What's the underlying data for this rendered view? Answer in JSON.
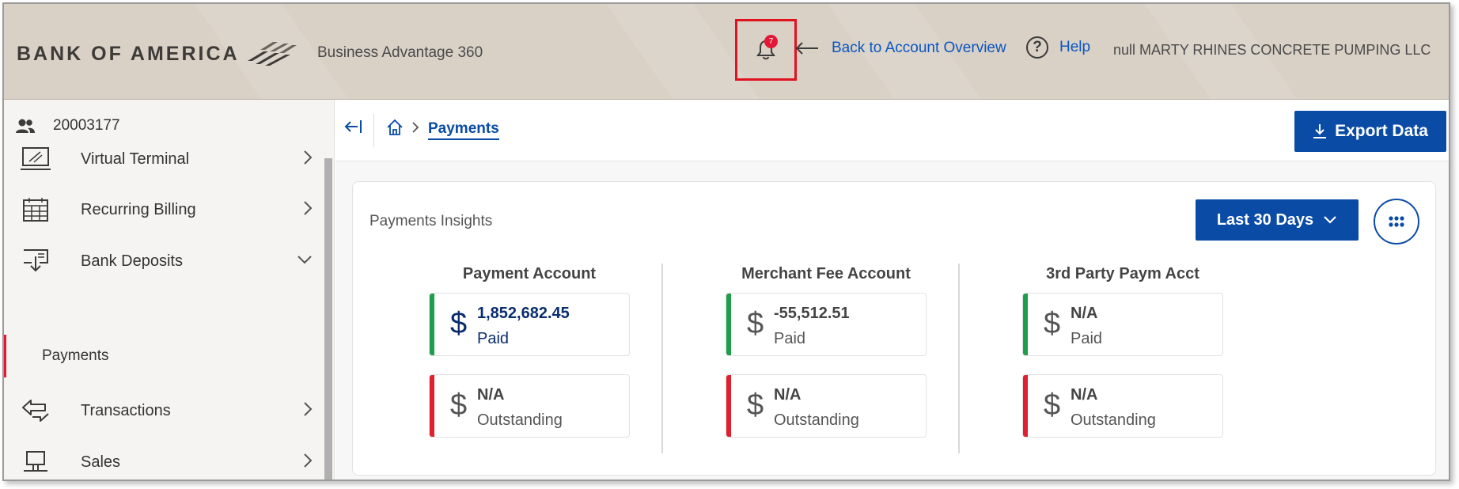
{
  "header": {
    "logo": "BANK OF AMERICA",
    "product": "Business Advantage 360",
    "notification_count": "7",
    "back_link": "Back to Account Overview",
    "help": "Help",
    "company": "null MARTY RHINES CONCRETE PUMPING LLC"
  },
  "sidebar": {
    "account_number": "20003177",
    "items": [
      {
        "label": "Virtual Terminal",
        "icon": "terminal-icon"
      },
      {
        "label": "Recurring Billing",
        "icon": "calendar-icon"
      },
      {
        "label": "Bank Deposits",
        "icon": "deposit-icon"
      },
      {
        "label": "Transactions",
        "icon": "transfer-arrows-icon"
      },
      {
        "label": "Sales",
        "icon": "register-icon"
      }
    ],
    "sub_item": "Payments"
  },
  "breadcrumb": {
    "current": "Payments"
  },
  "toolbar": {
    "export_label": "Export Data"
  },
  "insights": {
    "title": "Payments Insights",
    "range_label": "Last 30 Days",
    "columns": [
      {
        "title": "Payment Account",
        "paid_value": "1,852,682.45",
        "paid_label": "Paid",
        "outstanding_value": "N/A",
        "outstanding_label": "Outstanding"
      },
      {
        "title": "Merchant Fee Account",
        "paid_value": "-55,512.51",
        "paid_label": "Paid",
        "outstanding_value": "N/A",
        "outstanding_label": "Outstanding"
      },
      {
        "title": "3rd Party Paym Acct",
        "paid_value": "N/A",
        "paid_label": "Paid",
        "outstanding_value": "N/A",
        "outstanding_label": "Outstanding"
      }
    ],
    "currency_symbol": "$"
  },
  "colors": {
    "brand_blue": "#0a4ba6",
    "paid_green": "#1e9e4a",
    "outstanding_red": "#e0202e",
    "highlight_red": "#e0121f"
  }
}
